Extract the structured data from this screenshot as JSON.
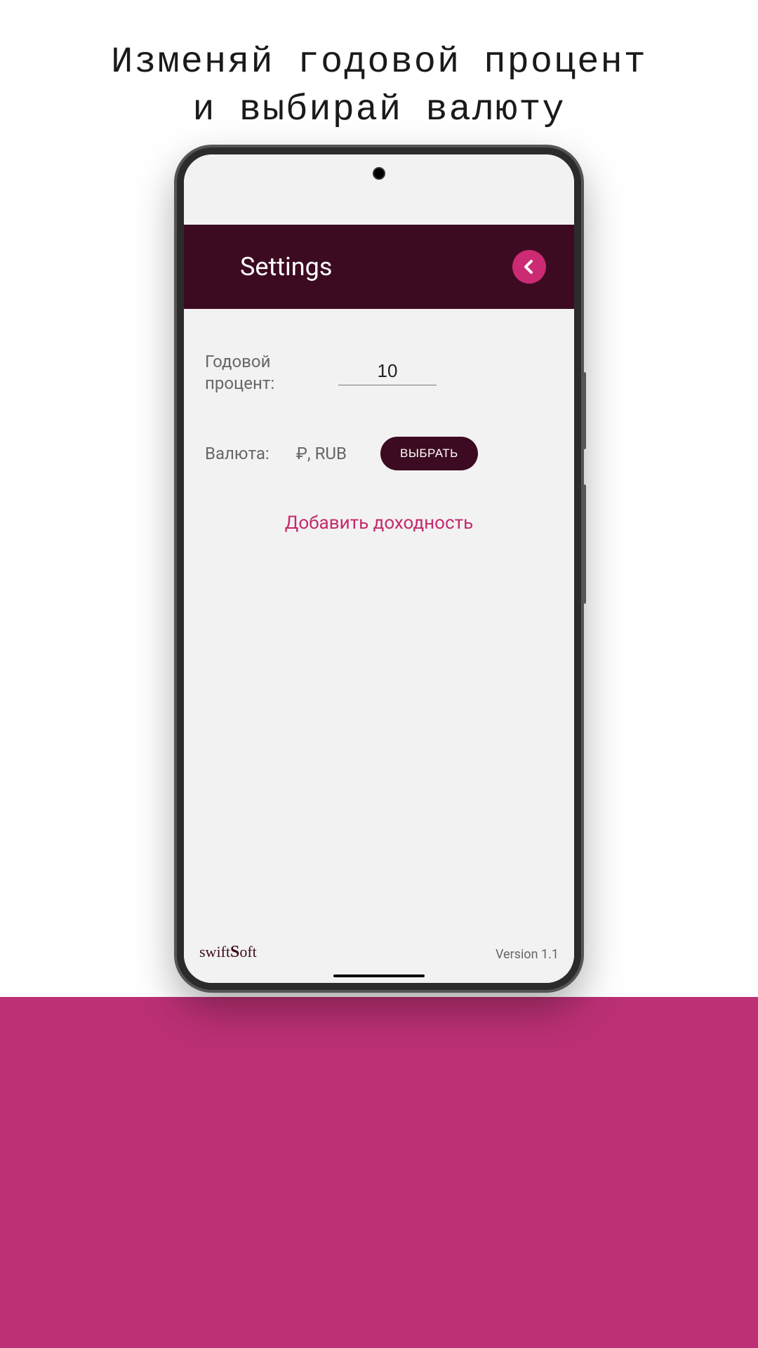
{
  "promo": {
    "headline": "Изменяй годовой процент\nи выбирай валюту"
  },
  "header": {
    "title": "Settings"
  },
  "settings": {
    "percent_label": "Годовой\nпроцент:",
    "percent_value": "10",
    "currency_label": "Валюта:",
    "currency_value": "₽, RUB",
    "choose_label": "ВЫБРАТЬ",
    "add_yield_label": "Добавить доходность"
  },
  "footer": {
    "brand_prefix": "swift",
    "brand_accent": "S",
    "brand_suffix": "oft",
    "version": "Version 1.1"
  },
  "colors": {
    "header_bg": "#3c0b21",
    "accent": "#cc2a72",
    "band": "#bc3075"
  }
}
